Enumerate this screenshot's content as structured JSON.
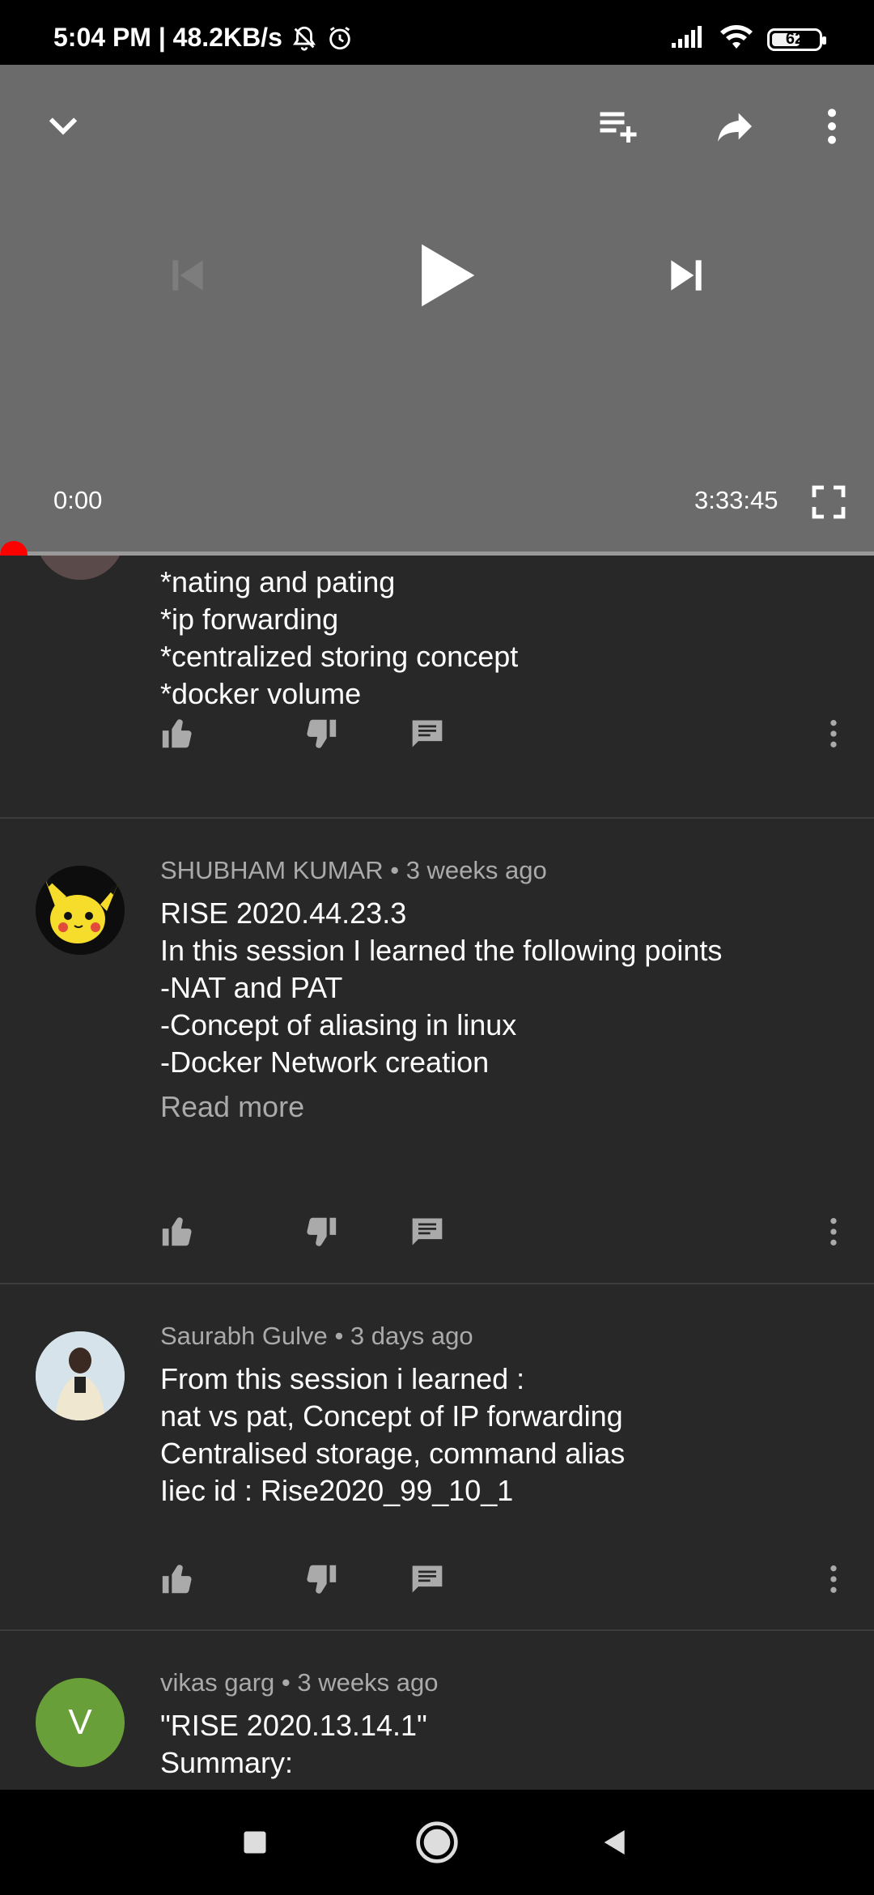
{
  "status_bar": {
    "time_speed": "5:04 PM | 48.2KB/s",
    "battery": "62",
    "icons": [
      "mute-icon",
      "alarm-icon",
      "signal-icon",
      "wifi-icon",
      "battery-icon"
    ]
  },
  "player": {
    "current_time": "0:00",
    "duration": "3:33:45",
    "progress_fraction": 0.0,
    "icons": [
      "collapse-icon",
      "add-to-queue-icon",
      "share-icon",
      "more-icon",
      "previous-icon",
      "play-icon",
      "next-icon",
      "fullscreen-icon"
    ]
  },
  "comments": [
    {
      "lines": [
        "*nating and pating",
        "*ip forwarding",
        "*centralized storing concept",
        "*docker volume"
      ]
    },
    {
      "author": "SHUBHAM KUMAR",
      "age": "3 weeks ago",
      "lines": [
        "RISE 2020.44.23.3",
        "In this session I learned the following points",
        "-NAT and PAT",
        "-Concept of aliasing in linux",
        "-Docker Network creation"
      ],
      "read_more": "Read more"
    },
    {
      "author": "Saurabh Gulve",
      "age": "3 days ago",
      "lines": [
        "From this session i learned :",
        "nat vs pat, Concept of IP forwarding",
        "Centralised storage, command alias",
        "Iiec id : Rise2020_99_10_1"
      ]
    },
    {
      "author": "vikas garg",
      "age": "3 weeks ago",
      "avatar_letter": "V",
      "avatar_color": "#689f38",
      "lines": [
        "\"RISE 2020.13.14.1\"",
        "Summary:"
      ]
    }
  ],
  "colors": {
    "background": "#282828",
    "player": "#6b6b6b",
    "progress": "#ff0000",
    "meta_text": "#aaaaaa"
  }
}
